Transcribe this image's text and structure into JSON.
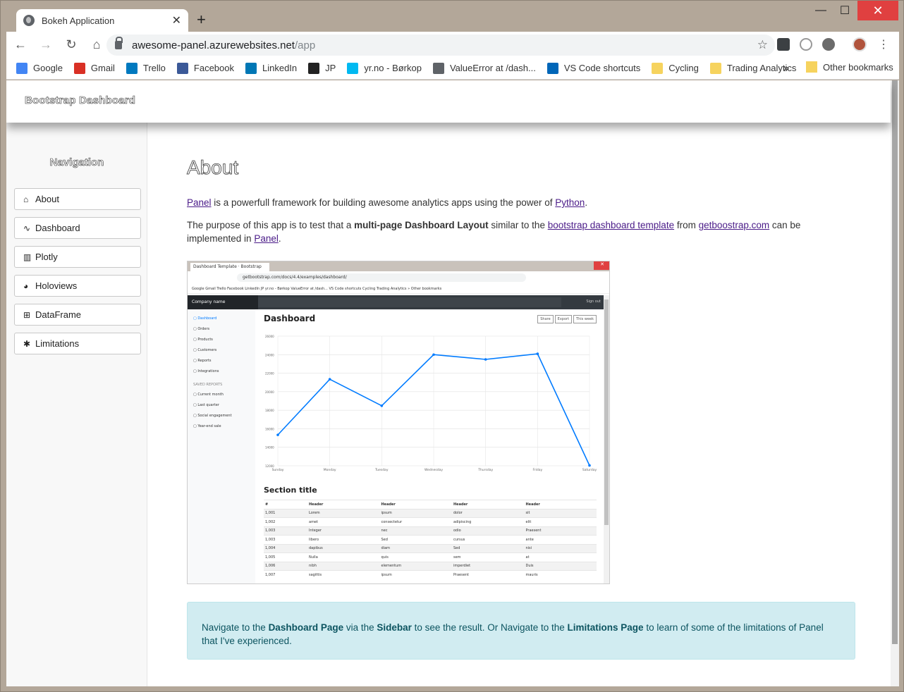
{
  "browser": {
    "tab_title": "Bokeh Application",
    "tab_close": "✕",
    "new_tab": "+",
    "window_controls": {
      "minimize": "—",
      "maximize": "☐",
      "close": "✕"
    },
    "url_host": "awesome-panel.azurewebsites.net",
    "url_path": "/app",
    "bookmarks": [
      {
        "label": "Google",
        "icon": "google-icon",
        "color": "#4285f4"
      },
      {
        "label": "Gmail",
        "icon": "gmail-icon",
        "color": "#d93025"
      },
      {
        "label": "Trello",
        "icon": "trello-icon",
        "color": "#0079bf"
      },
      {
        "label": "Facebook",
        "icon": "facebook-icon",
        "color": "#3b5998"
      },
      {
        "label": "LinkedIn",
        "icon": "linkedin-icon",
        "color": "#0077b5"
      },
      {
        "label": "JP",
        "icon": "jp-icon",
        "color": "#222222"
      },
      {
        "label": "yr.no - Børkop",
        "icon": "yr-icon",
        "color": "#00b9f1"
      },
      {
        "label": "ValueError at /dash...",
        "icon": "globe-icon",
        "color": "#5f6368"
      },
      {
        "label": "VS Code shortcuts",
        "icon": "vscode-icon",
        "color": "#0066b8"
      },
      {
        "label": "Cycling",
        "icon": "folder-icon",
        "color": "#f6d35e"
      },
      {
        "label": "Trading Analytics",
        "icon": "folder-icon",
        "color": "#f6d35e"
      }
    ],
    "bookmarks_more": "»",
    "other_bookmarks": "Other bookmarks"
  },
  "app": {
    "brand": "Bootstrap Dashboard",
    "nav_title": "Navigation",
    "nav_items": [
      {
        "label": "About",
        "icon": "home-icon",
        "glyph": "⌂"
      },
      {
        "label": "Dashboard",
        "icon": "line-chart-icon",
        "glyph": "∿"
      },
      {
        "label": "Plotly",
        "icon": "bar-chart-icon",
        "glyph": "▥"
      },
      {
        "label": "Holoviews",
        "icon": "pie-chart-icon",
        "glyph": "◕"
      },
      {
        "label": "DataFrame",
        "icon": "table-icon",
        "glyph": "⊞"
      },
      {
        "label": "Limitations",
        "icon": "bug-icon",
        "glyph": "✱"
      }
    ],
    "page_title": "About",
    "p1": {
      "link1": "Panel",
      "text1": " is a powerfull framework for building awesome analytics apps using the power of ",
      "link2": "Python",
      "text2": "."
    },
    "p2": {
      "text1": "The purpose of this app is to test that a ",
      "bold1": "multi-page Dashboard Layout",
      "text2": " similar to the ",
      "link1": "bootstrap dashboard template",
      "text3": " from ",
      "link2": "getboostrap.com",
      "text4": " can be implemented in ",
      "link3": "Panel",
      "text5": "."
    },
    "alert": {
      "t1": "Navigate to the ",
      "b1": "Dashboard Page",
      "t2": " via the ",
      "b2": "Sidebar",
      "t3": " to see the result. Or Navigate to the ",
      "b3": "Limitations Page",
      "t4": " to learn of some of the limitations of Panel that I've experienced."
    }
  },
  "embedded_screenshot": {
    "tab_title": "Dashboard Template · Bootstrap",
    "url": "getbootstrap.com/docs/4.4/examples/dashboard/",
    "bookmarks_text": "Google   Gmail   Trello   Facebook   LinkedIn   JP   yr.no - Børkop   ValueError at /dash...   VS Code shortcuts   Cycling   Trading Analytics   »   Other bookmarks",
    "company": "Company name",
    "search": "Search",
    "signout": "Sign out",
    "side_items": [
      "Dashboard",
      "Orders",
      "Products",
      "Customers",
      "Reports",
      "Integrations"
    ],
    "saved_reports_title": "SAVED REPORTS",
    "saved_items": [
      "Current month",
      "Last quarter",
      "Social engagement",
      "Year-end sale"
    ],
    "heading": "Dashboard",
    "buttons": [
      "Share",
      "Export",
      "This week"
    ],
    "section_title": "Section title",
    "table_header": [
      "#",
      "Header",
      "Header",
      "Header",
      "Header"
    ],
    "table_rows": [
      [
        "1,001",
        "Lorem",
        "ipsum",
        "dolor",
        "sit"
      ],
      [
        "1,002",
        "amet",
        "consectetur",
        "adipiscing",
        "elit"
      ],
      [
        "1,003",
        "Integer",
        "nec",
        "odio",
        "Praesent"
      ],
      [
        "1,003",
        "libero",
        "Sed",
        "cursus",
        "ante"
      ],
      [
        "1,004",
        "dapibus",
        "diam",
        "Sed",
        "nisi"
      ],
      [
        "1,005",
        "Nulla",
        "quis",
        "sem",
        "at"
      ],
      [
        "1,006",
        "nibh",
        "elementum",
        "imperdiet",
        "Duis"
      ],
      [
        "1,007",
        "sagittis",
        "ipsum",
        "Praesent",
        "mauris"
      ]
    ],
    "chart_data": {
      "type": "line",
      "categories": [
        "Sunday",
        "Monday",
        "Tuesday",
        "Wednesday",
        "Thursday",
        "Friday",
        "Saturday"
      ],
      "values": [
        15339,
        21345,
        18483,
        24003,
        23489,
        24092,
        12034
      ],
      "ylim": [
        12000,
        26000
      ],
      "yticks": [
        "26000",
        "24000",
        "22000",
        "20000",
        "18000",
        "16000",
        "14000",
        "12000"
      ],
      "color": "#007bff",
      "grid": true
    }
  }
}
